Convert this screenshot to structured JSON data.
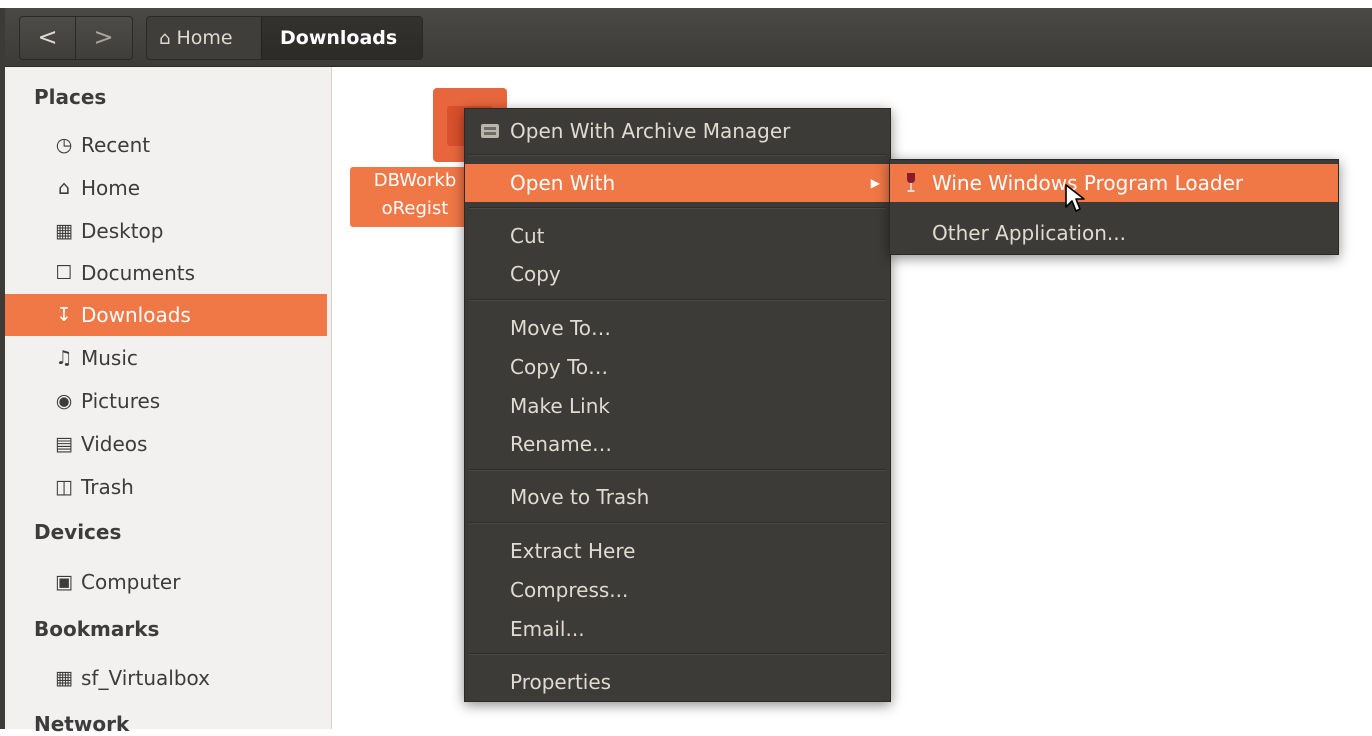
{
  "window": {
    "navigation": {
      "back": "<",
      "forward": ">"
    },
    "breadcrumb": {
      "home": "Home",
      "current": "Downloads"
    }
  },
  "sidebar": {
    "sections": [
      {
        "title": "Places"
      },
      {
        "title": "Devices"
      },
      {
        "title": "Bookmarks"
      },
      {
        "title": "Network"
      }
    ],
    "items": [
      {
        "label": "Recent",
        "icon": "clock-icon"
      },
      {
        "label": "Home",
        "icon": "home-icon"
      },
      {
        "label": "Desktop",
        "icon": "folder-icon"
      },
      {
        "label": "Documents",
        "icon": "document-icon"
      },
      {
        "label": "Downloads",
        "icon": "download-icon",
        "active": true
      },
      {
        "label": "Music",
        "icon": "music-icon"
      },
      {
        "label": "Pictures",
        "icon": "camera-icon"
      },
      {
        "label": "Videos",
        "icon": "film-icon"
      },
      {
        "label": "Trash",
        "icon": "trash-icon"
      },
      {
        "label": "Computer",
        "icon": "computer-icon"
      },
      {
        "label": "sf_Virtualbox",
        "icon": "folder-icon"
      }
    ]
  },
  "file": {
    "line1": "DBWorkb",
    "line2": "oRegist"
  },
  "context_menu": {
    "items": [
      {
        "label": "Open With Archive Manager",
        "icon": "archive-manager-icon"
      },
      {
        "label": "Open With",
        "highlighted": true,
        "submenu": true
      },
      {
        "label": "Cut"
      },
      {
        "label": "Copy"
      },
      {
        "label": "Move To…"
      },
      {
        "label": "Copy To…"
      },
      {
        "label": "Make Link"
      },
      {
        "label": "Rename…"
      },
      {
        "label": "Move to Trash"
      },
      {
        "label": "Extract Here"
      },
      {
        "label": "Compress..."
      },
      {
        "label": "Email..."
      },
      {
        "label": "Properties"
      }
    ]
  },
  "submenu": {
    "items": [
      {
        "label": "Wine Windows Program Loader",
        "icon": "wine-icon",
        "highlighted": true
      },
      {
        "label": "Other Application..."
      }
    ]
  },
  "colors": {
    "accent": "#f07746",
    "menu_bg": "#3c3b37",
    "toolbar_bg": "#3c3b37",
    "sidebar_bg": "#f2f1f0"
  }
}
